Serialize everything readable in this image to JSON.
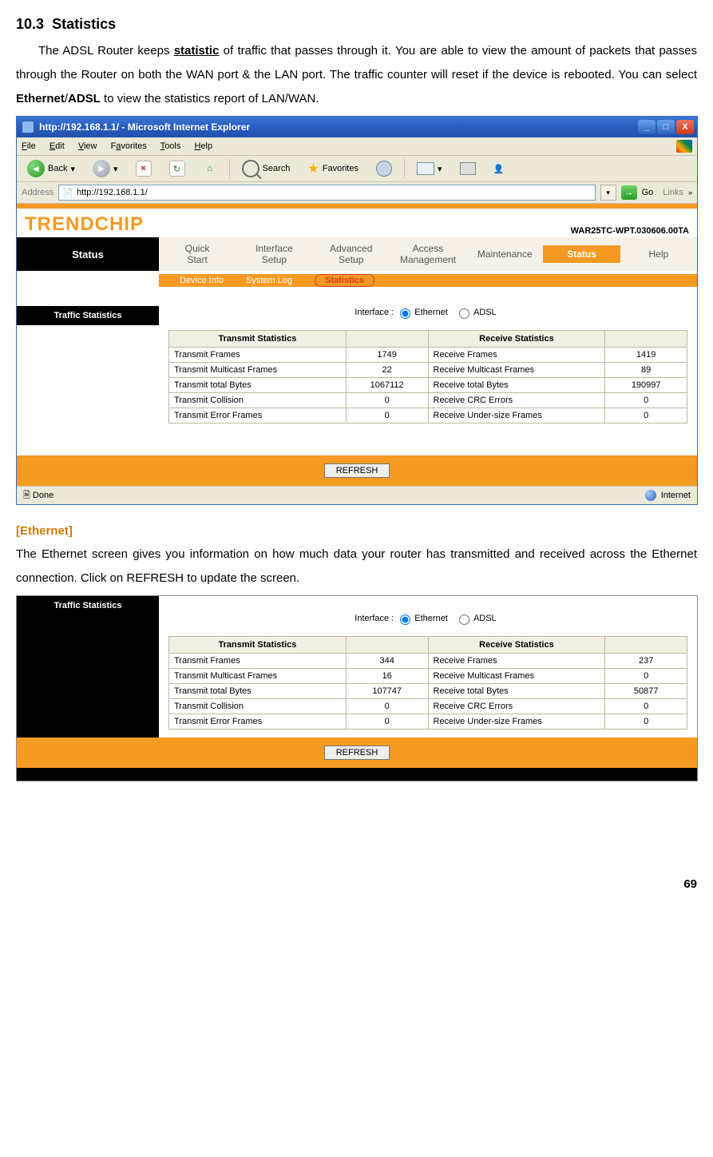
{
  "section": {
    "number": "10.3",
    "title": "Statistics"
  },
  "intro_parts": {
    "t1": "The ADSL Router keeps ",
    "statistic": "statistic",
    "t2": " of traffic that passes through it. You are able to view the amount of packets that passes through the Router on both the WAN port & the LAN port. The traffic counter will reset if the device is rebooted. You can select ",
    "eth": "Ethernet",
    "slash": "/",
    "adsl": "ADSL",
    "t3": " to view the statistics report of LAN/WAN."
  },
  "window": {
    "title": "http://192.168.1.1/ - Microsoft Internet Explorer",
    "menus": {
      "file": "File",
      "edit": "Edit",
      "view": "View",
      "favorites": "Favorites",
      "tools": "Tools",
      "help": "Help"
    },
    "toolbar": {
      "back": "Back",
      "search": "Search",
      "favorites": "Favorites"
    },
    "address_label": "Address",
    "url": "http://192.168.1.1/",
    "go": "Go",
    "links": "Links",
    "status_text": "Done",
    "status_zone": "Internet"
  },
  "router": {
    "brand": "TRENDCHIP",
    "fw": "WAR25TC-WPT.030606.00TA",
    "status": "Status",
    "tabs": {
      "quick": "Quick\nStart",
      "iface": "Interface\nSetup",
      "adv": "Advanced\nSetup",
      "access": "Access\nManagement",
      "maint": "Maintenance",
      "status": "Status",
      "help": "Help"
    },
    "subnav": {
      "device": "Device Info",
      "syslog": "System Log",
      "stats": "Statistics"
    },
    "section_label": "Traffic Statistics",
    "iface_label": "Interface :",
    "iface_eth": "Ethernet",
    "iface_adsl": "ADSL",
    "table_headers": {
      "tx": "Transmit Statistics",
      "rx": "Receive Statistics"
    },
    "refresh": "REFRESH"
  },
  "stats1": {
    "rows": [
      {
        "txl": "Transmit Frames",
        "txv": "1749",
        "rxl": "Receive Frames",
        "rxv": "1419"
      },
      {
        "txl": "Transmit Multicast Frames",
        "txv": "22",
        "rxl": "Receive Multicast Frames",
        "rxv": "89"
      },
      {
        "txl": "Transmit total Bytes",
        "txv": "1067112",
        "rxl": "Receive total Bytes",
        "rxv": "190997"
      },
      {
        "txl": "Transmit Collision",
        "txv": "0",
        "rxl": "Receive CRC Errors",
        "rxv": "0"
      },
      {
        "txl": "Transmit Error Frames",
        "txv": "0",
        "rxl": "Receive Under-size Frames",
        "rxv": "0"
      }
    ]
  },
  "eth_heading": "[Ethernet]",
  "eth_text": "The Ethernet screen gives you information on how much data your router has transmitted and received across the Ethernet connection. Click on REFRESH to update the screen.",
  "stats2": {
    "rows": [
      {
        "txl": "Transmit Frames",
        "txv": "344",
        "rxl": "Receive Frames",
        "rxv": "237"
      },
      {
        "txl": "Transmit Multicast Frames",
        "txv": "16",
        "rxl": "Receive Multicast Frames",
        "rxv": "0"
      },
      {
        "txl": "Transmit total Bytes",
        "txv": "107747",
        "rxl": "Receive total Bytes",
        "rxv": "50877"
      },
      {
        "txl": "Transmit Collision",
        "txv": "0",
        "rxl": "Receive CRC Errors",
        "rxv": "0"
      },
      {
        "txl": "Transmit Error Frames",
        "txv": "0",
        "rxl": "Receive Under-size Frames",
        "rxv": "0"
      }
    ]
  },
  "page_number": "69"
}
